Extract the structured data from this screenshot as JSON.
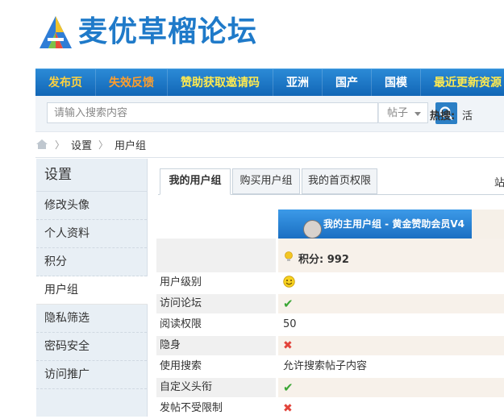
{
  "logo": {
    "text": "麦优草榴论坛",
    "icon": "a-letter-logo"
  },
  "nav": [
    {
      "label": "发布页",
      "style": "hl-red"
    },
    {
      "label": "失效反馈",
      "style": "hl-orange"
    },
    {
      "label": "赞助获取邀请码",
      "style": "hl-yellow"
    },
    {
      "label": "亚洲",
      "style": ""
    },
    {
      "label": "国产",
      "style": ""
    },
    {
      "label": "国模",
      "style": ""
    },
    {
      "label": "最近更新资源",
      "style": "hl-yellow"
    }
  ],
  "search": {
    "placeholder": "请输入搜索内容",
    "type_selected": "帖子",
    "hot_label": "热搜:",
    "hot_link": "活",
    "button_icon": "search-icon"
  },
  "breadcrumb": {
    "home_icon": "home-icon",
    "items": [
      "设置",
      "用户组"
    ]
  },
  "sidebar": {
    "title": "设置",
    "items": [
      "修改头像",
      "个人资料",
      "积分",
      "用户组",
      "隐私筛选",
      "密码安全",
      "访问推广"
    ],
    "active_index": 3
  },
  "tabs": [
    "我的用户组",
    "购买用户组",
    "我的首页权限"
  ],
  "tabs_right_text": "站",
  "group": {
    "title": "我的主用户组 - 黄金赞助会员V4",
    "credit_text": "积分: 992",
    "rows": [
      {
        "label": "用户级别",
        "value": "",
        "icon": "smiley-icon"
      },
      {
        "label": "访问论坛",
        "value": "",
        "icon": "check-icon"
      },
      {
        "label": "阅读权限",
        "value": "50",
        "icon": ""
      },
      {
        "label": "隐身",
        "value": "",
        "icon": "cross-icon"
      },
      {
        "label": "使用搜索",
        "value": "允许搜索帖子内容",
        "icon": ""
      },
      {
        "label": "自定义头衔",
        "value": "",
        "icon": "check-icon"
      },
      {
        "label": "发帖不受限制",
        "value": "",
        "icon": "cross-icon"
      }
    ]
  },
  "colors": {
    "nav_blue": "#1a6fc2",
    "brand_blue": "#1f7ac9"
  }
}
